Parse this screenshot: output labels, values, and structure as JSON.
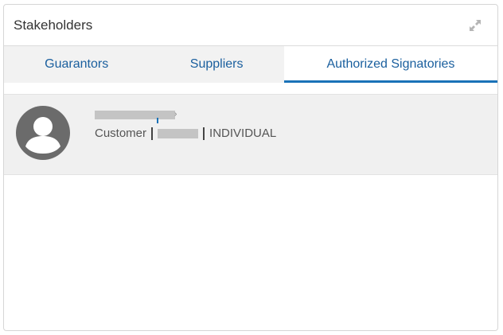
{
  "panel": {
    "title": "Stakeholders",
    "expand_icon": "expand-arrows-icon"
  },
  "tabs": [
    {
      "label": "Guarantors",
      "active": false
    },
    {
      "label": "Suppliers",
      "active": false
    },
    {
      "label": "Authorized Signatories",
      "active": true
    }
  ],
  "stakeholders": [
    {
      "avatar_icon": "user-avatar-icon",
      "name_redacted": true,
      "role": "Customer",
      "id_redacted": true,
      "type": "INDIVIDUAL"
    }
  ],
  "colors": {
    "accent": "#1a72b8",
    "tab_text": "#1a5f9e",
    "tab_bg": "#f2f2f2",
    "row_bg": "#f0f0f0",
    "avatar": "#6b6b6b"
  }
}
